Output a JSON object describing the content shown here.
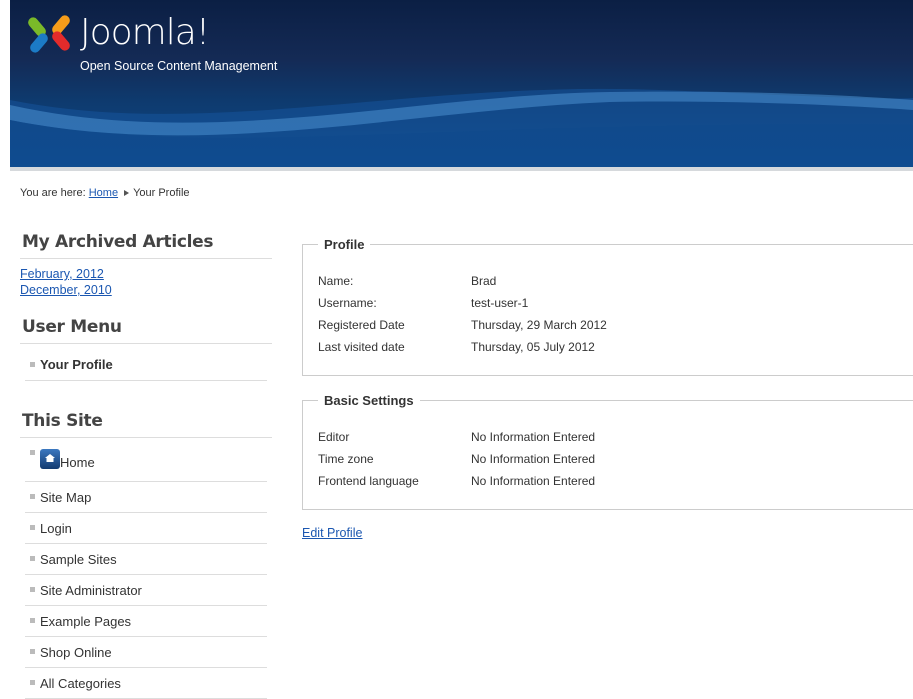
{
  "header": {
    "logo_text": "Joomla!",
    "tagline": "Open Source Content Management"
  },
  "breadcrumb": {
    "prefix": "You are here:",
    "home": "Home",
    "current": "Your Profile"
  },
  "archived": {
    "title": "My Archived Articles",
    "items": [
      "February, 2012",
      "December, 2010"
    ]
  },
  "user_menu": {
    "title": "User Menu",
    "items": [
      "Your Profile"
    ]
  },
  "this_site": {
    "title": "This Site",
    "items": [
      "Home",
      "Site Map",
      "Login",
      "Sample Sites",
      "Site Administrator",
      "Example Pages",
      "Shop Online",
      "All Categories"
    ]
  },
  "profile": {
    "legend": "Profile",
    "rows": [
      [
        "Name:",
        "Brad"
      ],
      [
        "Username:",
        "test-user-1"
      ],
      [
        "Registered Date",
        "Thursday, 29 March 2012"
      ],
      [
        "Last visited date",
        "Thursday, 05 July 2012"
      ]
    ]
  },
  "basic": {
    "legend": "Basic Settings",
    "rows": [
      [
        "Editor",
        "No Information Entered"
      ],
      [
        "Time zone",
        "No Information Entered"
      ],
      [
        "Frontend language",
        "No Information Entered"
      ]
    ]
  },
  "edit_profile": "Edit Profile"
}
